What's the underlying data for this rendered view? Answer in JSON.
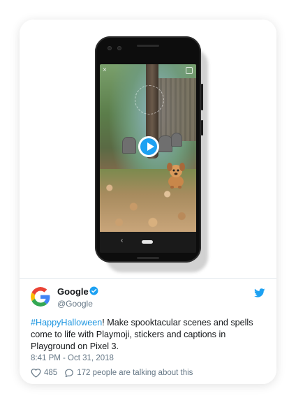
{
  "info_icon": "i",
  "media": {
    "play_icon": "play-icon",
    "nav_back_glyph": "‹",
    "close_glyph": "×"
  },
  "tweet": {
    "author_name": "Google",
    "handle": "@Google",
    "verified": true,
    "hashtag": "#HappyHalloween",
    "text": "! Make spooktacular scenes and spells come to life with Playmoji, stickers and captions in Playground on Pixel 3.",
    "timestamp": "8:41 PM - Oct 31, 2018",
    "likes": "485",
    "conversation": "172 people are talking about this"
  },
  "colors": {
    "link_blue": "#1b95e0",
    "twitter_blue": "#1da1f2",
    "secondary_text": "#657786"
  }
}
